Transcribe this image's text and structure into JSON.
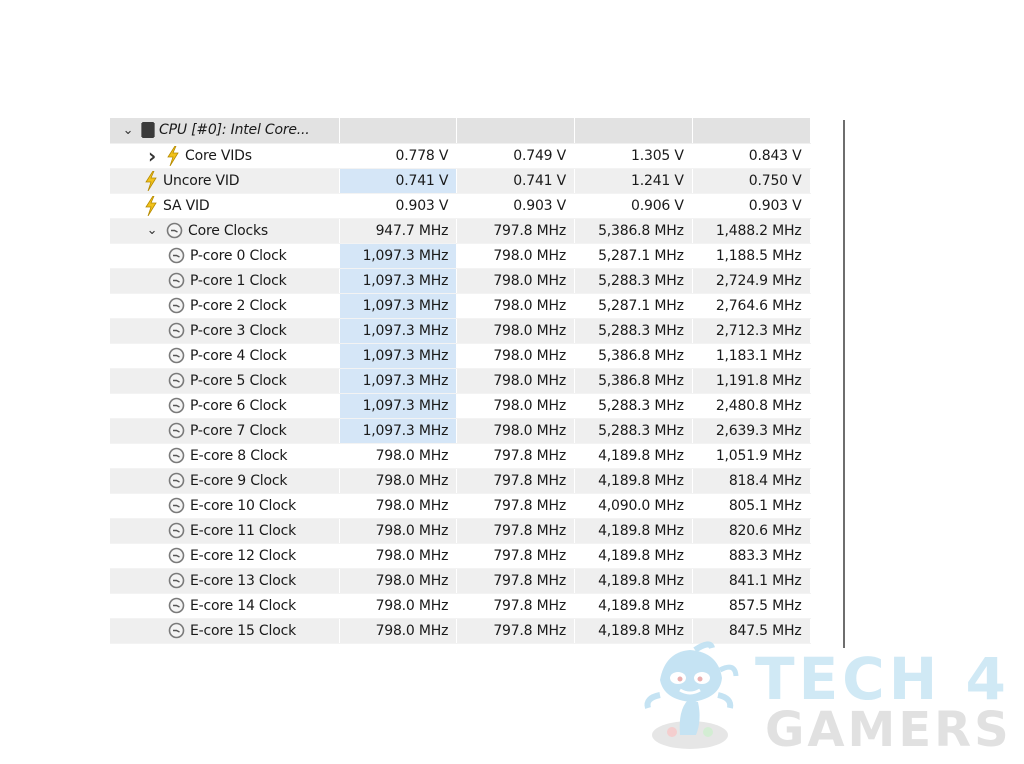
{
  "tree": {
    "header": {
      "label": "CPU [#0]: Intel Core...",
      "icon": "chip-icon",
      "expanded": true
    },
    "rows": [
      {
        "label": "Core VIDs",
        "icon": "bolt-icon",
        "expander": "collapsed",
        "level": 1,
        "values": [
          "0.778 V",
          "0.749 V",
          "1.305 V",
          "0.843 V"
        ],
        "highlight_first": false
      },
      {
        "label": "Uncore VID",
        "icon": "bolt-icon",
        "expander": "none",
        "level": 0,
        "values": [
          "0.741 V",
          "0.741 V",
          "1.241 V",
          "0.750 V"
        ],
        "highlight_first": true
      },
      {
        "label": "SA VID",
        "icon": "bolt-icon",
        "expander": "none",
        "level": 0,
        "values": [
          "0.903 V",
          "0.903 V",
          "0.906 V",
          "0.903 V"
        ],
        "highlight_first": false
      },
      {
        "label": "Core Clocks",
        "icon": "clock-icon",
        "expander": "expanded",
        "level": 1,
        "values": [
          "947.7 MHz",
          "797.8 MHz",
          "5,386.8 MHz",
          "1,488.2 MHz"
        ],
        "highlight_first": false
      },
      {
        "label": "P-core 0 Clock",
        "icon": "clock-icon",
        "expander": "none",
        "level": 2,
        "values": [
          "1,097.3 MHz",
          "798.0 MHz",
          "5,287.1 MHz",
          "1,188.5 MHz"
        ],
        "highlight_first": true
      },
      {
        "label": "P-core 1 Clock",
        "icon": "clock-icon",
        "expander": "none",
        "level": 2,
        "values": [
          "1,097.3 MHz",
          "798.0 MHz",
          "5,288.3 MHz",
          "2,724.9 MHz"
        ],
        "highlight_first": true
      },
      {
        "label": "P-core 2 Clock",
        "icon": "clock-icon",
        "expander": "none",
        "level": 2,
        "values": [
          "1,097.3 MHz",
          "798.0 MHz",
          "5,287.1 MHz",
          "2,764.6 MHz"
        ],
        "highlight_first": true
      },
      {
        "label": "P-core 3 Clock",
        "icon": "clock-icon",
        "expander": "none",
        "level": 2,
        "values": [
          "1,097.3 MHz",
          "798.0 MHz",
          "5,288.3 MHz",
          "2,712.3 MHz"
        ],
        "highlight_first": true
      },
      {
        "label": "P-core 4 Clock",
        "icon": "clock-icon",
        "expander": "none",
        "level": 2,
        "values": [
          "1,097.3 MHz",
          "798.0 MHz",
          "5,386.8 MHz",
          "1,183.1 MHz"
        ],
        "highlight_first": true
      },
      {
        "label": "P-core 5 Clock",
        "icon": "clock-icon",
        "expander": "none",
        "level": 2,
        "values": [
          "1,097.3 MHz",
          "798.0 MHz",
          "5,386.8 MHz",
          "1,191.8 MHz"
        ],
        "highlight_first": true
      },
      {
        "label": "P-core 6 Clock",
        "icon": "clock-icon",
        "expander": "none",
        "level": 2,
        "values": [
          "1,097.3 MHz",
          "798.0 MHz",
          "5,288.3 MHz",
          "2,480.8 MHz"
        ],
        "highlight_first": true
      },
      {
        "label": "P-core 7 Clock",
        "icon": "clock-icon",
        "expander": "none",
        "level": 2,
        "values": [
          "1,097.3 MHz",
          "798.0 MHz",
          "5,288.3 MHz",
          "2,639.3 MHz"
        ],
        "highlight_first": true
      },
      {
        "label": "E-core 8 Clock",
        "icon": "clock-icon",
        "expander": "none",
        "level": 2,
        "values": [
          "798.0 MHz",
          "797.8 MHz",
          "4,189.8 MHz",
          "1,051.9 MHz"
        ],
        "highlight_first": false
      },
      {
        "label": "E-core 9 Clock",
        "icon": "clock-icon",
        "expander": "none",
        "level": 2,
        "values": [
          "798.0 MHz",
          "797.8 MHz",
          "4,189.8 MHz",
          "818.4 MHz"
        ],
        "highlight_first": false
      },
      {
        "label": "E-core 10 Clock",
        "icon": "clock-icon",
        "expander": "none",
        "level": 2,
        "values": [
          "798.0 MHz",
          "797.8 MHz",
          "4,090.0 MHz",
          "805.1 MHz"
        ],
        "highlight_first": false
      },
      {
        "label": "E-core 11 Clock",
        "icon": "clock-icon",
        "expander": "none",
        "level": 2,
        "values": [
          "798.0 MHz",
          "797.8 MHz",
          "4,189.8 MHz",
          "820.6 MHz"
        ],
        "highlight_first": false
      },
      {
        "label": "E-core 12 Clock",
        "icon": "clock-icon",
        "expander": "none",
        "level": 2,
        "values": [
          "798.0 MHz",
          "797.8 MHz",
          "4,189.8 MHz",
          "883.3 MHz"
        ],
        "highlight_first": false
      },
      {
        "label": "E-core 13 Clock",
        "icon": "clock-icon",
        "expander": "none",
        "level": 2,
        "values": [
          "798.0 MHz",
          "797.8 MHz",
          "4,189.8 MHz",
          "841.1 MHz"
        ],
        "highlight_first": false
      },
      {
        "label": "E-core 14 Clock",
        "icon": "clock-icon",
        "expander": "none",
        "level": 2,
        "values": [
          "798.0 MHz",
          "797.8 MHz",
          "4,189.8 MHz",
          "857.5 MHz"
        ],
        "highlight_first": false
      },
      {
        "label": "E-core 15 Clock",
        "icon": "clock-icon",
        "expander": "none",
        "level": 2,
        "values": [
          "798.0 MHz",
          "797.8 MHz",
          "4,189.8 MHz",
          "847.5 MHz"
        ],
        "highlight_first": false
      }
    ]
  },
  "colors": {
    "highlight": "#d5e6f7",
    "row_alt": "#efefef",
    "header_bg": "#e2e2e2",
    "bolt": "#f2c21b",
    "watermark_blue": "#cce7f5",
    "watermark_gray": "#dedede"
  },
  "watermark": {
    "line1": "TECH 4",
    "line2": "GAMERS"
  }
}
